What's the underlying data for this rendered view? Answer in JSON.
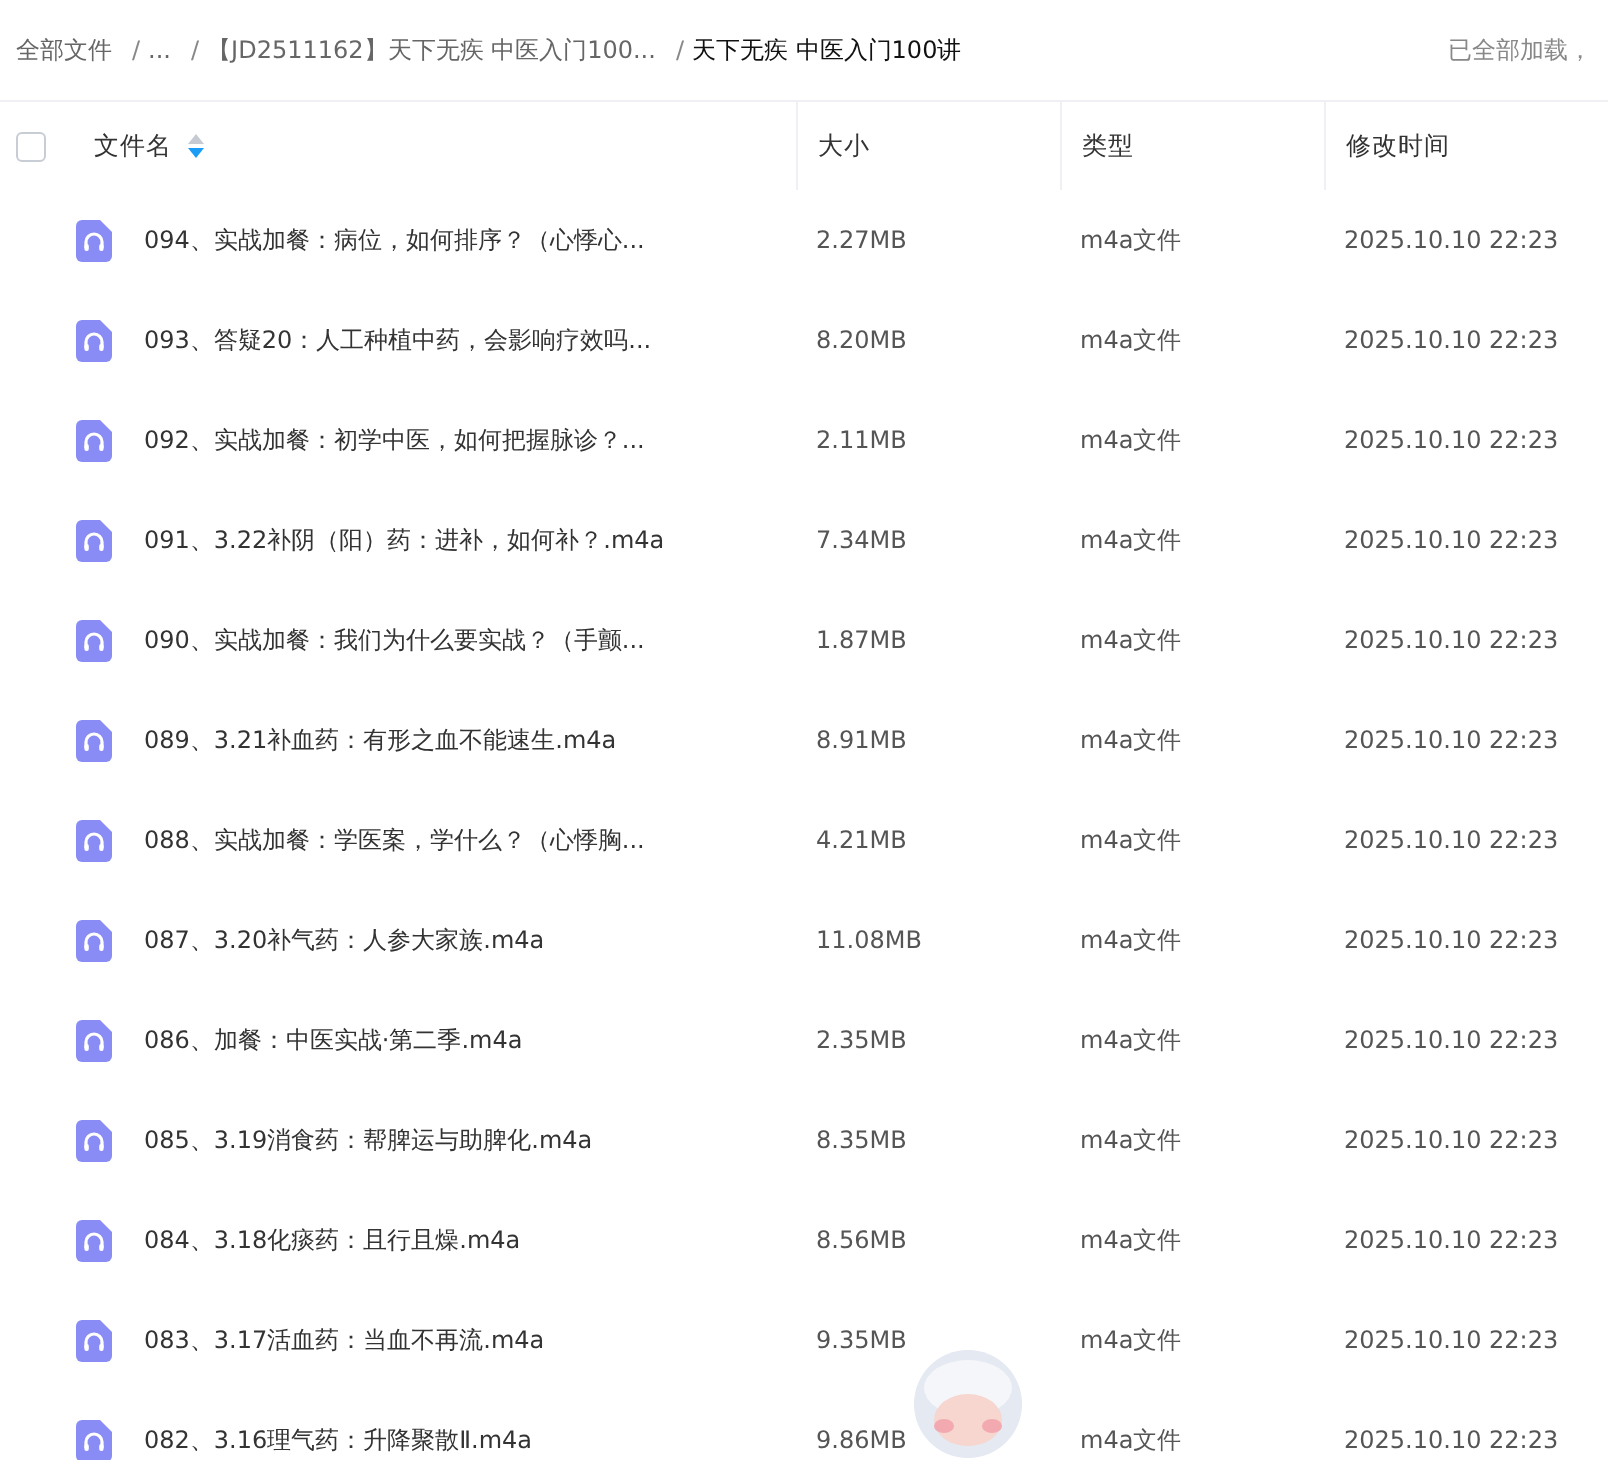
{
  "breadcrumb": [
    {
      "label": "全部文件",
      "current": false
    },
    {
      "label": "...",
      "current": false
    },
    {
      "label": "【JD2511162】天下无疾 中医入门100...",
      "current": false
    },
    {
      "label": "天下无疾 中医入门100讲",
      "current": true
    }
  ],
  "breadcrumb_separator": "/",
  "load_status": "已全部加载，",
  "table": {
    "select_all": {
      "checked": false
    },
    "columns": [
      {
        "label": "文件名",
        "sorted_descending": true
      },
      {
        "label": "大小"
      },
      {
        "label": "类型"
      },
      {
        "label": "修改时间"
      }
    ],
    "rows": [
      {
        "name": "094、实战加餐：病位，如何排序？（心悸心...",
        "size": "2.27MB",
        "type": "m4a文件",
        "modified": "2025.10.10 22:23"
      },
      {
        "name": "093、答疑20：人工种植中药，会影响疗效吗...",
        "size": "8.20MB",
        "type": "m4a文件",
        "modified": "2025.10.10 22:23"
      },
      {
        "name": "092、实战加餐：初学中医，如何把握脉诊？...",
        "size": "2.11MB",
        "type": "m4a文件",
        "modified": "2025.10.10 22:23"
      },
      {
        "name": "091、3.22补阴（阳）药：进补，如何补？.m4a",
        "size": "7.34MB",
        "type": "m4a文件",
        "modified": "2025.10.10 22:23"
      },
      {
        "name": "090、实战加餐：我们为什么要实战？（手颤...",
        "size": "1.87MB",
        "type": "m4a文件",
        "modified": "2025.10.10 22:23"
      },
      {
        "name": "089、3.21补血药：有形之血不能速生.m4a",
        "size": "8.91MB",
        "type": "m4a文件",
        "modified": "2025.10.10 22:23"
      },
      {
        "name": "088、实战加餐：学医案，学什么？（心悸胸...",
        "size": "4.21MB",
        "type": "m4a文件",
        "modified": "2025.10.10 22:23"
      },
      {
        "name": "087、3.20补气药：人参大家族.m4a",
        "size": "11.08MB",
        "type": "m4a文件",
        "modified": "2025.10.10 22:23"
      },
      {
        "name": "086、加餐：中医实战·第二季.m4a",
        "size": "2.35MB",
        "type": "m4a文件",
        "modified": "2025.10.10 22:23"
      },
      {
        "name": "085、3.19消食药：帮脾运与助脾化.m4a",
        "size": "8.35MB",
        "type": "m4a文件",
        "modified": "2025.10.10 22:23"
      },
      {
        "name": "084、3.18化痰药：且行且燥.m4a",
        "size": "8.56MB",
        "type": "m4a文件",
        "modified": "2025.10.10 22:23"
      },
      {
        "name": "083、3.17活血药：当血不再流.m4a",
        "size": "9.35MB",
        "type": "m4a文件",
        "modified": "2025.10.10 22:23"
      },
      {
        "name": "082、3.16理气药：升降聚散Ⅱ.m4a",
        "size": "9.86MB",
        "type": "m4a文件",
        "modified": "2025.10.10 22:23"
      }
    ]
  }
}
